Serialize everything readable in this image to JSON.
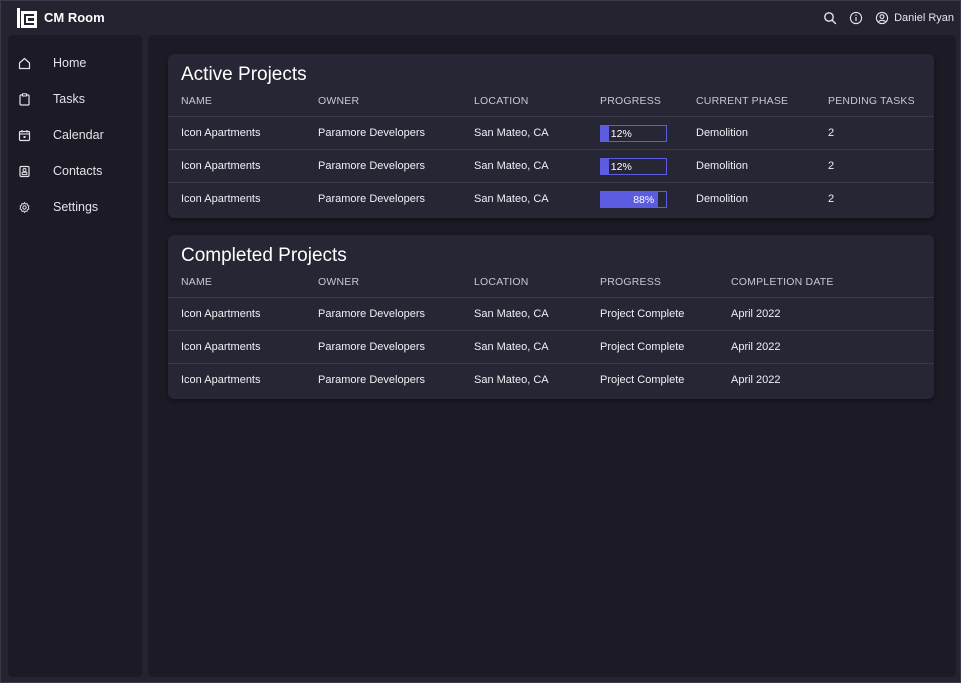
{
  "app": {
    "title": "CM Room"
  },
  "topbar": {
    "user_name": "Daniel Ryan"
  },
  "sidebar": {
    "items": [
      {
        "label": "Home",
        "icon": "home-icon"
      },
      {
        "label": "Tasks",
        "icon": "clipboard-icon"
      },
      {
        "label": "Calendar",
        "icon": "calendar-icon"
      },
      {
        "label": "Contacts",
        "icon": "contacts-icon"
      },
      {
        "label": "Settings",
        "icon": "gear-icon"
      }
    ]
  },
  "colors": {
    "accent": "#5c5ce0",
    "background": "#24232f",
    "panel": "#1b1a25",
    "card": "#272635"
  },
  "active": {
    "title": "Active Projects",
    "headers": [
      "NAME",
      "OWNER",
      "LOCATION",
      "PROGRESS",
      "CURRENT PHASE",
      "PENDING TASKS"
    ],
    "rows": [
      {
        "name": "Icon Apartments",
        "owner": "Paramore Developers",
        "location": "San Mateo, CA",
        "progress": 12,
        "progress_label": "12%",
        "phase": "Demolition",
        "pending": "2"
      },
      {
        "name": "Icon Apartments",
        "owner": "Paramore Developers",
        "location": "San Mateo, CA",
        "progress": 12,
        "progress_label": "12%",
        "phase": "Demolition",
        "pending": "2"
      },
      {
        "name": "Icon Apartments",
        "owner": "Paramore Developers",
        "location": "San Mateo, CA",
        "progress": 88,
        "progress_label": "88%",
        "phase": "Demolition",
        "pending": "2"
      }
    ]
  },
  "completed": {
    "title": "Completed Projects",
    "headers": [
      "NAME",
      "OWNER",
      "LOCATION",
      "PROGRESS",
      "COMPLETION DATE"
    ],
    "rows": [
      {
        "name": "Icon Apartments",
        "owner": "Paramore Developers",
        "location": "San Mateo, CA",
        "progress": "Project Complete",
        "date": "April 2022"
      },
      {
        "name": "Icon Apartments",
        "owner": "Paramore Developers",
        "location": "San Mateo, CA",
        "progress": "Project Complete",
        "date": "April 2022"
      },
      {
        "name": "Icon Apartments",
        "owner": "Paramore Developers",
        "location": "San Mateo, CA",
        "progress": "Project Complete",
        "date": "April 2022"
      }
    ]
  }
}
